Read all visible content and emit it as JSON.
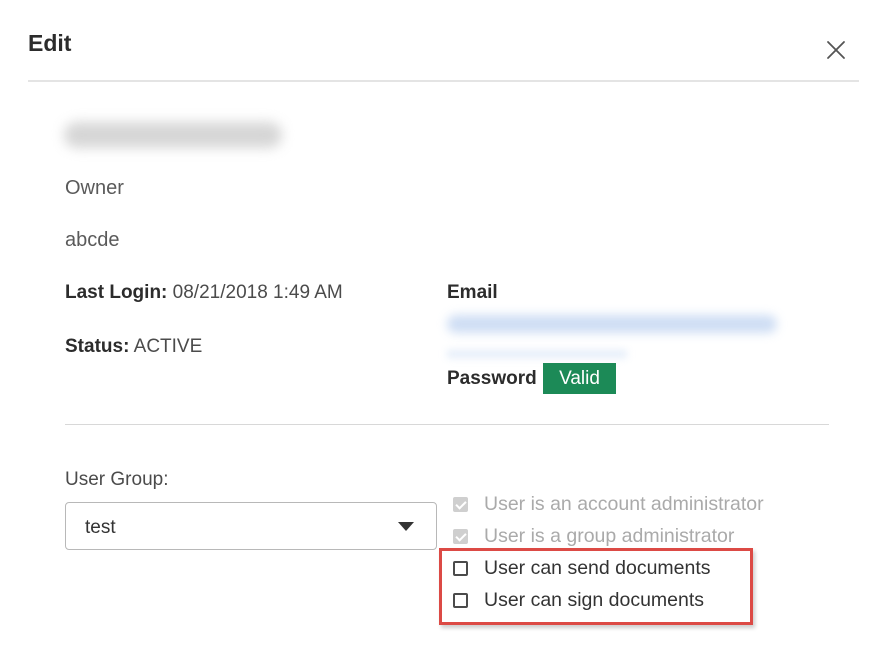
{
  "dialog": {
    "title": "Edit",
    "close_icon": "close-icon"
  },
  "user": {
    "role": "Owner",
    "organization": "abcde",
    "last_login_label": "Last Login:",
    "last_login_value": "08/21/2018 1:49 AM",
    "status_label": "Status:",
    "status_value": "ACTIVE",
    "email_label": "Email",
    "password_label": "Password",
    "password_status": "Valid"
  },
  "group": {
    "label": "User Group:",
    "selected": "test",
    "caret_icon": "caret-down-icon"
  },
  "permissions": [
    {
      "label": "User is an account administrator",
      "checked": true,
      "disabled": true
    },
    {
      "label": "User is a group administrator",
      "checked": true,
      "disabled": true
    },
    {
      "label": "User can send documents",
      "checked": false,
      "disabled": false
    },
    {
      "label": "User can sign documents",
      "checked": false,
      "disabled": false
    }
  ],
  "colors": {
    "valid_badge": "#1c8a57",
    "highlight_border": "#dc4a45",
    "disabled_text": "#aaaaaa"
  }
}
